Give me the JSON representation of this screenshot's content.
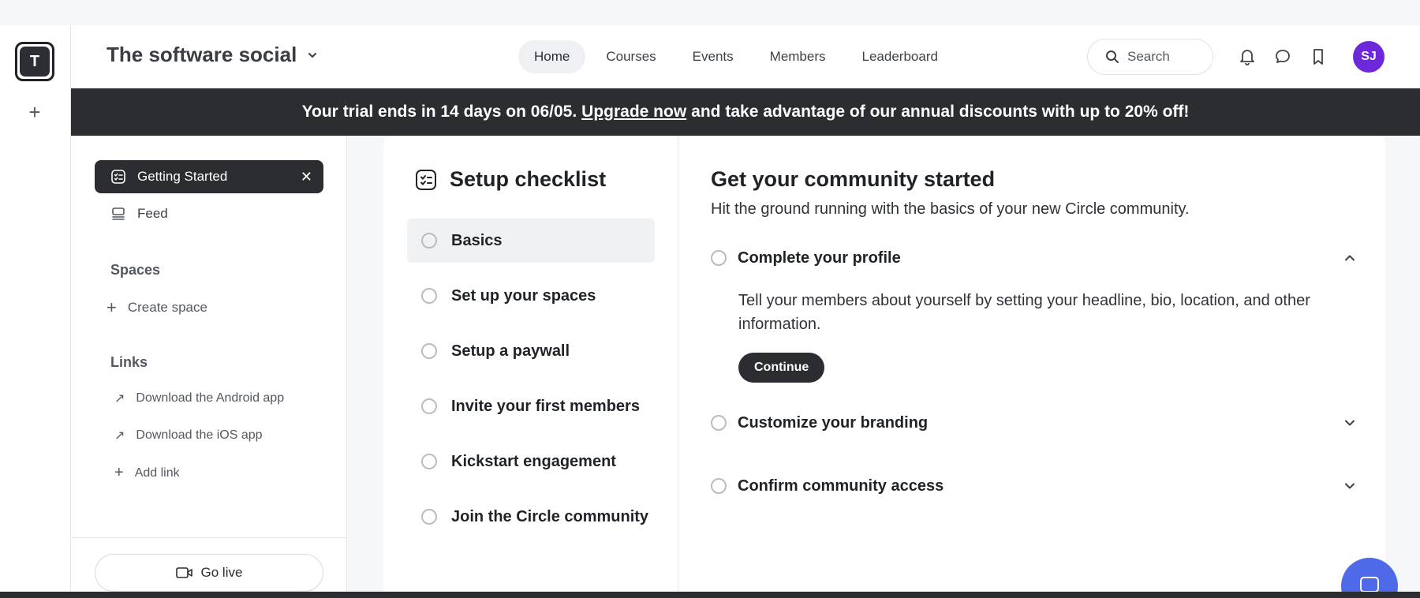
{
  "rail": {
    "logo_letter": "T",
    "add_label": "+"
  },
  "header": {
    "community_name": "The software social",
    "nav": [
      {
        "label": "Home",
        "active": true
      },
      {
        "label": "Courses",
        "active": false
      },
      {
        "label": "Events",
        "active": false
      },
      {
        "label": "Members",
        "active": false
      },
      {
        "label": "Leaderboard",
        "active": false
      }
    ],
    "search_label": "Search",
    "avatar_initials": "SJ",
    "avatar_color": "#6d28d9"
  },
  "banner": {
    "text_before": "Your trial ends in 14 days on 06/05.",
    "link_text": "Upgrade now",
    "text_after": "and take advantage of our annual discounts with up to 20% off!"
  },
  "sidebar": {
    "getting_started": "Getting Started",
    "feed": "Feed",
    "spaces_heading": "Spaces",
    "create_space": "Create space",
    "links_heading": "Links",
    "links": [
      {
        "label": "Download the Android app",
        "icon": "arrow-up-right-icon"
      },
      {
        "label": "Download the iOS app",
        "icon": "arrow-up-right-icon"
      },
      {
        "label": "Add link",
        "icon": "plus-icon"
      }
    ],
    "go_live": "Go live"
  },
  "checklist": {
    "title": "Setup checklist",
    "items": [
      {
        "label": "Basics",
        "active": true
      },
      {
        "label": "Set up your spaces",
        "active": false
      },
      {
        "label": "Setup a paywall",
        "active": false
      },
      {
        "label": "Invite your first members",
        "active": false
      },
      {
        "label": "Kickstart engagement",
        "active": false
      },
      {
        "label": "Join the Circle community",
        "active": false
      }
    ]
  },
  "detail": {
    "title": "Get your community started",
    "subtitle": "Hit the ground running with the basics of your new Circle community.",
    "steps": [
      {
        "label": "Complete your profile",
        "expanded": true
      },
      {
        "label": "Customize your branding",
        "expanded": false
      },
      {
        "label": "Confirm community access",
        "expanded": false
      }
    ],
    "step_description": "Tell your members about yourself by setting your headline, bio, location, and other information.",
    "continue_label": "Continue"
  }
}
